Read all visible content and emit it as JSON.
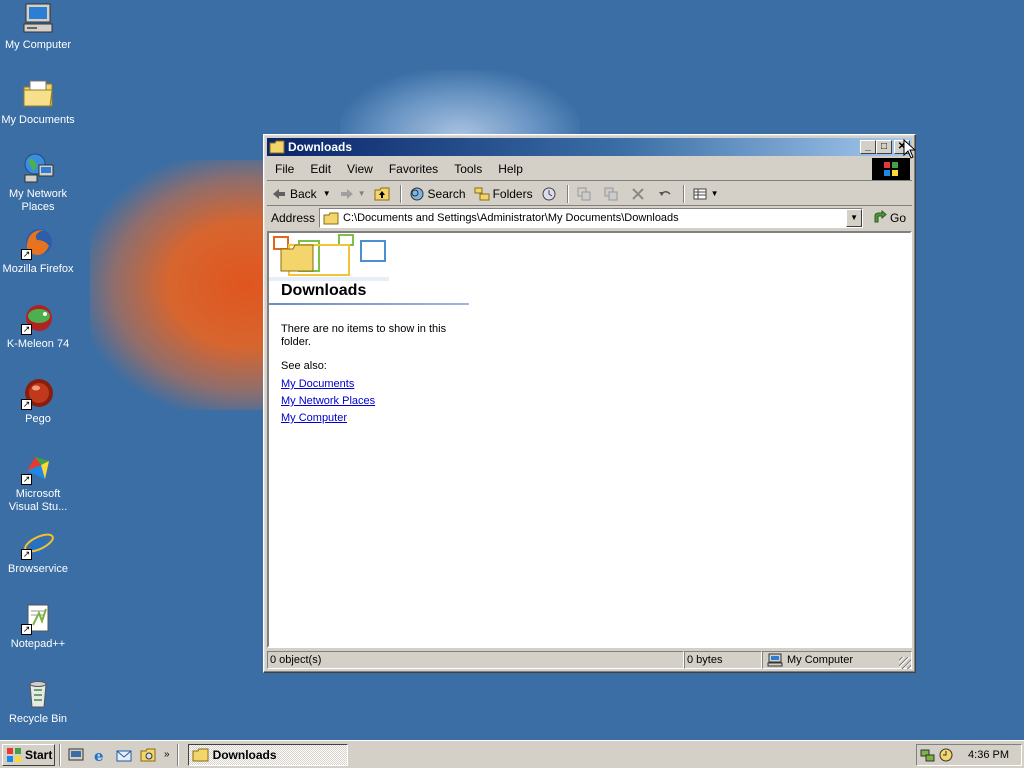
{
  "desktop": {
    "icons": [
      {
        "label": "My Computer",
        "icon": "my-computer-icon",
        "shortcut": false
      },
      {
        "label": "My Documents",
        "icon": "my-documents-icon",
        "shortcut": false
      },
      {
        "label": "My Network Places",
        "icon": "network-places-icon",
        "shortcut": false
      },
      {
        "label": "Mozilla Firefox",
        "icon": "firefox-icon",
        "shortcut": true
      },
      {
        "label": "K-Meleon 74",
        "icon": "k-meleon-icon",
        "shortcut": true
      },
      {
        "label": "Pego",
        "icon": "pego-icon",
        "shortcut": true
      },
      {
        "label": "Microsoft Visual Stu...",
        "icon": "visual-studio-icon",
        "shortcut": true
      },
      {
        "label": "Browservice",
        "icon": "internet-explorer-icon",
        "shortcut": true
      },
      {
        "label": "Notepad++",
        "icon": "notepad-plus-plus-icon",
        "shortcut": true
      },
      {
        "label": "Recycle Bin",
        "icon": "recycle-bin-icon",
        "shortcut": false
      }
    ]
  },
  "window": {
    "title": "Downloads",
    "menu": [
      "File",
      "Edit",
      "View",
      "Favorites",
      "Tools",
      "Help"
    ],
    "toolbar": {
      "back": "Back",
      "search": "Search",
      "folders": "Folders"
    },
    "address": {
      "label": "Address",
      "value": "C:\\Documents and Settings\\Administrator\\My Documents\\Downloads",
      "go": "Go"
    },
    "content": {
      "folder_title": "Downloads",
      "empty_message": "There are no items to show in this folder.",
      "see_also_label": "See also:",
      "links": [
        "My Documents",
        "My Network Places",
        "My Computer"
      ]
    },
    "status": {
      "objects": "0 object(s)",
      "size": "0 bytes",
      "zone": "My Computer"
    }
  },
  "taskbar": {
    "start": "Start",
    "task": "Downloads",
    "clock": "4:36 PM"
  },
  "colors": {
    "desktop": "#3a6ea5",
    "titlebar_start": "#0a246a",
    "titlebar_end": "#a6caf0",
    "face": "#d4d0c8",
    "link": "#0000cc"
  }
}
